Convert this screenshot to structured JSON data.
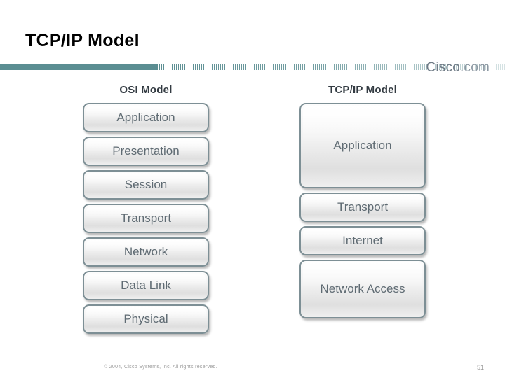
{
  "header": {
    "title": "TCP/IP Model",
    "logo_text": "Cisco",
    "logo_suffix": ".com"
  },
  "diagram": {
    "osi": {
      "heading": "OSI Model",
      "layers": [
        "Application",
        "Presentation",
        "Session",
        "Transport",
        "Network",
        "Data Link",
        "Physical"
      ]
    },
    "tcpip": {
      "heading": "TCP/IP Model",
      "layers": [
        "Application",
        "Transport",
        "Internet",
        "Network Access"
      ]
    }
  },
  "footer": {
    "copyright": "© 2004, Cisco Systems, Inc. All rights reserved.",
    "page_number": "51"
  },
  "colors": {
    "rule": "#5b8e92",
    "box_border": "#7d8f95",
    "box_text": "#5f6b73",
    "heading_text": "#333b42"
  }
}
